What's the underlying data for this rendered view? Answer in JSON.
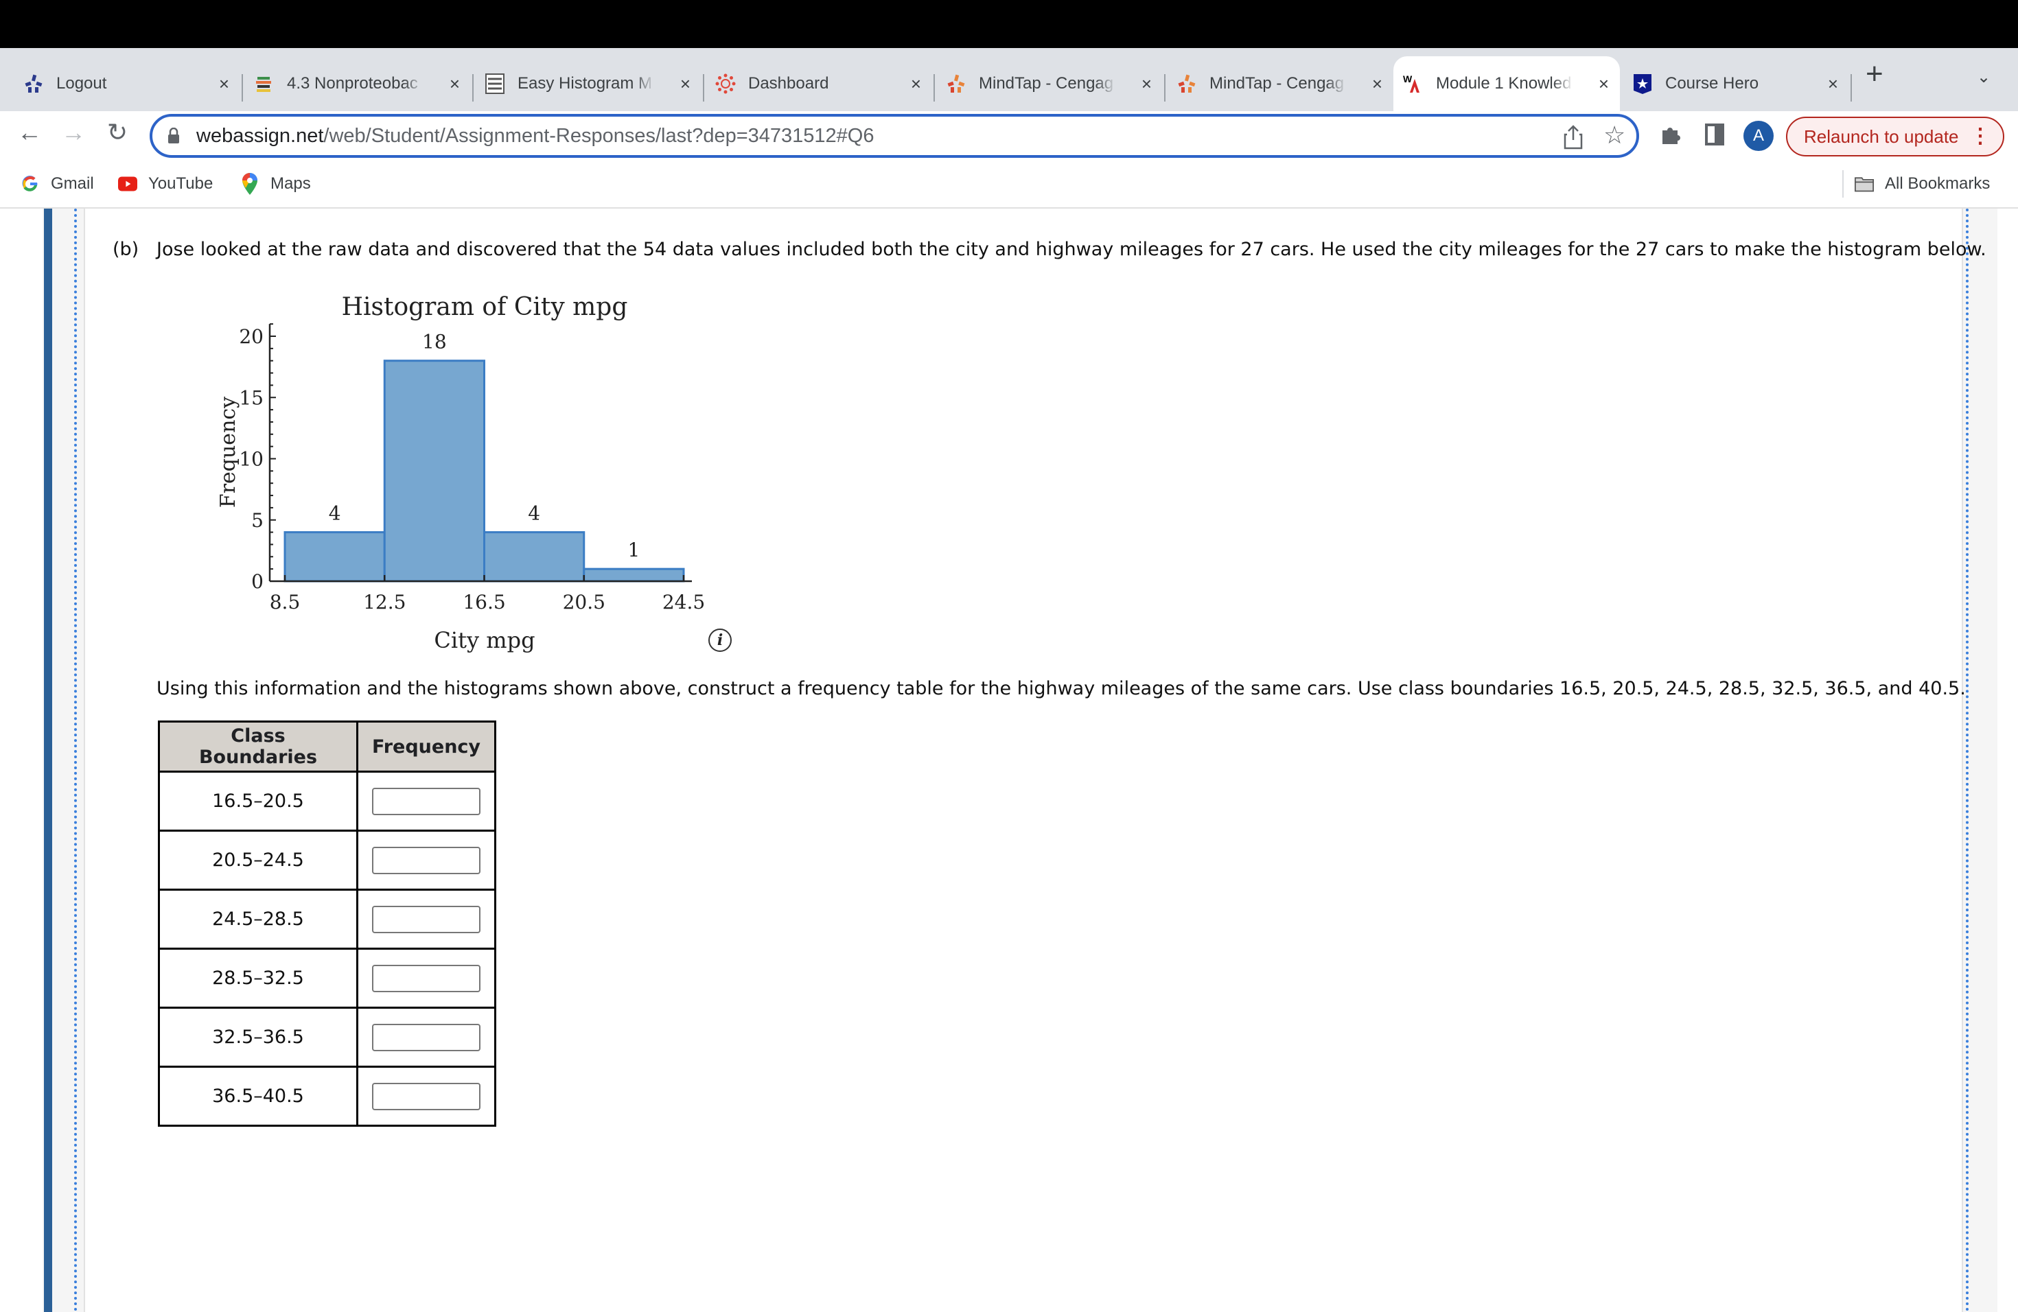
{
  "browser": {
    "tabs": [
      {
        "label": "Logout",
        "icon": "mindtap-blue-icon",
        "active": false
      },
      {
        "label": "4.3 Nonproteobac",
        "icon": "book-stack-icon",
        "active": false
      },
      {
        "label": "Easy Histogram M",
        "icon": "social-science-statistics-icon",
        "active": false
      },
      {
        "label": "Dashboard",
        "icon": "canvas-icon",
        "active": false
      },
      {
        "label": "MindTap - Cengag",
        "icon": "mindtap-orange-icon",
        "active": false
      },
      {
        "label": "MindTap - Cengag",
        "icon": "mindtap-orange-icon",
        "active": false
      },
      {
        "label": "Module 1 Knowled",
        "icon": "webassign-icon",
        "active": true
      },
      {
        "label": "Course Hero",
        "icon": "course-hero-icon",
        "active": false
      }
    ],
    "tab_close_glyph": "×",
    "new_tab_glyph": "+",
    "tab_menu_glyph": "⌄",
    "url_host": "webassign.net",
    "url_path": "/web/Student/Assignment-Responses/last?dep=34731512#Q6",
    "avatar_letter": "A",
    "relaunch_label": "Relaunch to update",
    "bookmarks": [
      {
        "label": "Gmail",
        "icon": "google-icon"
      },
      {
        "label": "YouTube",
        "icon": "youtube-icon"
      },
      {
        "label": "Maps",
        "icon": "maps-icon"
      }
    ],
    "all_bookmarks_label": "All Bookmarks"
  },
  "question": {
    "part_label": "(b)",
    "intro": "Jose looked at the raw data and discovered that the 54 data values included both the city and highway mileages for 27 cars. He used the city mileages for the 27 cars to make the histogram below.",
    "instruction": "Using this information and the histograms shown above, construct a frequency table for the highway mileages of the same cars. Use class boundaries 16.5, 20.5, 24.5, 28.5, 32.5, 36.5, and 40.5.",
    "info_glyph": "i"
  },
  "chart_data": {
    "type": "bar",
    "title": "Histogram of City mpg",
    "xlabel": "City mpg",
    "ylabel": "Frequency",
    "bin_edges": [
      8.5,
      12.5,
      16.5,
      20.5,
      24.5
    ],
    "values": [
      4,
      18,
      4,
      1
    ],
    "data_labels": [
      "4",
      "18",
      "4",
      "1"
    ],
    "x_ticks": [
      "8.5",
      "12.5",
      "16.5",
      "20.5",
      "24.5"
    ],
    "y_ticks": [
      0,
      5,
      10,
      15,
      20
    ],
    "ylim": [
      0,
      21
    ],
    "xlim": [
      8.5,
      24.5
    ],
    "bar_color": "#77a7d0",
    "bar_edge_color": "#3b7dc4",
    "grid": false
  },
  "table": {
    "headers": [
      "Class Boundaries",
      "Frequency"
    ],
    "rows": [
      {
        "class": "16.5–20.5",
        "frequency": ""
      },
      {
        "class": "20.5–24.5",
        "frequency": ""
      },
      {
        "class": "24.5–28.5",
        "frequency": ""
      },
      {
        "class": "28.5–32.5",
        "frequency": ""
      },
      {
        "class": "32.5–36.5",
        "frequency": ""
      },
      {
        "class": "36.5–40.5",
        "frequency": ""
      }
    ]
  }
}
